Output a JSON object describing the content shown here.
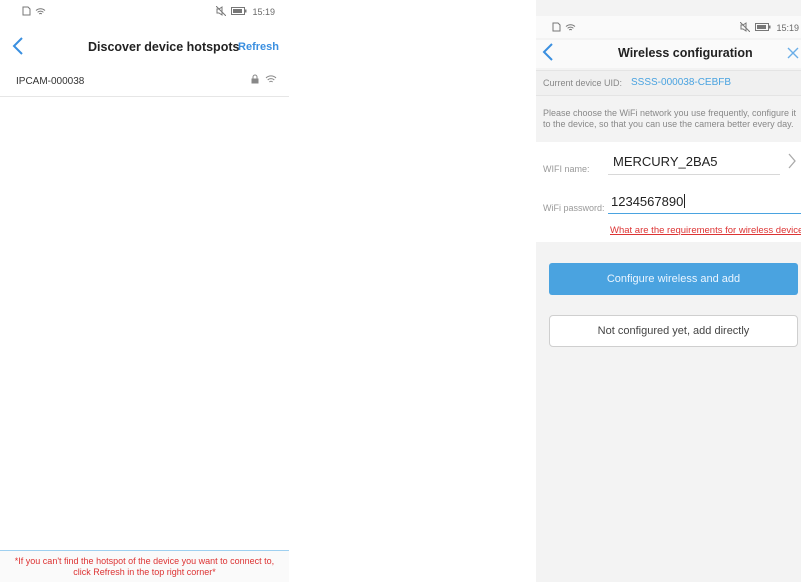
{
  "left": {
    "status": {
      "time": "15:19"
    },
    "nav": {
      "title": "Discover device hotspots",
      "action": "Refresh"
    },
    "hotspots": [
      {
        "name": "IPCAM-000038"
      }
    ],
    "footer": "*If you can't find the hotspot of the device you want to connect to, click Refresh in the top right corner*"
  },
  "right": {
    "status": {
      "time": "15:19"
    },
    "nav": {
      "title": "Wireless configuration"
    },
    "uid": {
      "label": "Current device UID:",
      "value": "SSSS-000038-CEBFB"
    },
    "intro": {
      "line1": "Please choose the WiFi network you use frequently, configure it",
      "line2": "to the device, so that you can use the camera better every day."
    },
    "wifi_name": {
      "label": "WIFI name:",
      "value": "MERCURY_2BA5"
    },
    "wifi_password": {
      "label": "WiFi password:",
      "value": "1234567890"
    },
    "requirements_link": "What are the requirements for wireless devices",
    "primary_button": "Configure wireless and add",
    "secondary_button": "Not configured yet, add directly"
  },
  "colors": {
    "accent": "#4aa3e0",
    "warning": "#dd3333"
  },
  "icons": {
    "status_left": [
      "sim-icon",
      "wifi-icon"
    ],
    "status_right": [
      "mute-icon",
      "battery-icon"
    ],
    "back": "chevron-left-icon",
    "close": "close-icon",
    "lock": "lock-icon",
    "signal": "wifi-icon",
    "select": "chevron-right-icon"
  }
}
